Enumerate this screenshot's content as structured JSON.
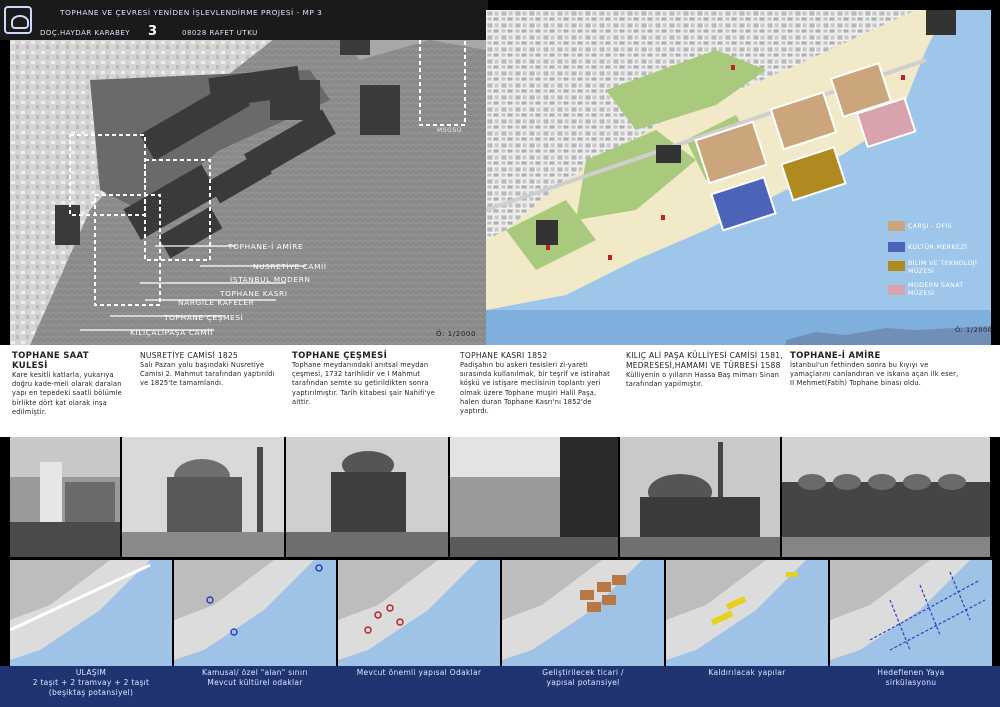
{
  "header": {
    "title": "TOPHANE VE ÇEVRESİ YENİDEN İŞLEVLENDİRME PROJESİ  - MP 3",
    "author": "DOÇ.HAYDAR KARABEY",
    "mp_number": "3",
    "student": "08028 RAFET UTKU"
  },
  "aerial": {
    "labels": [
      "TOPHANE-İ AMİRE",
      "NUSRETİYE CAMİİ",
      "İSTANBUL MODERN",
      "TOPHANE KASRI",
      "NARGİLE KAFELER",
      "TOPHANE ÇEŞMESİ",
      "KILIÇALİPAŞA CAMİİ"
    ],
    "msgsu": "MSGSÜ",
    "scale": "Ö: 1/2000"
  },
  "plan": {
    "legend": [
      {
        "label": "ÇARŞI - OFİS",
        "color": "#cba57b"
      },
      {
        "label": "KÜLTÜR MERKEZİ",
        "color": "#4b63b8"
      },
      {
        "label": "BİLİM VE TEKNOLOJİ MÜZESİ",
        "color": "#b08a1e"
      },
      {
        "label": "MODERN SANAT MÜZESİ",
        "color": "#d9a3ad"
      }
    ],
    "scale": "Ö: 1/2000"
  },
  "columns": [
    {
      "title": "TOPHANE SAAT KULESİ",
      "subtitle": "",
      "body": "Kare kesitli katlarla, yukarıya doğru kade-meli olarak daralan yapı en tepedeki saatli bölümle birlikte dört kat olarak inşa edilmiştir."
    },
    {
      "title": "",
      "subtitle": "NUSRETİYE CAMİSİ 1825",
      "body": "Salı Pazarı yolu başındaki Nusretiye Camisi 2. Mahmut tarafından yaptırıldı ve 1825'te tamamlandı."
    },
    {
      "title": "TOPHANE ÇEŞMESİ",
      "subtitle": "",
      "body": "Tophane meydanındaki anıtsal meydan çeşmesi, 1732 tarihlidir ve I Mahmut tarafından semte su getirildikten sonra yaptırılmıştır. Tarih kitabesi şair Nahifi'ye aittir."
    },
    {
      "title": "",
      "subtitle": "TOPHANE KASRI 1852",
      "body": "Padişahın bu askeri tesisleri zi-yareti sırasında kullanılmak, bir teşrif ve istirahat köşkü ve istişare meclisinin toplantı yeri olmak üzere Tophane muşiri Halil Paşa, halen duran Tophane Kasrı'nı 1852'de yaptırdı."
    },
    {
      "title": "",
      "subtitle": "KILIÇ ALİ PAŞA KÜLLİYESİ CAMİSİ 1581, MEDRESESİ,HAMAMI VE TÜRBESİ 1588",
      "body": "Külliyenin o yılların Hassa Baş mimarı Sinan tarafından yapılmıştır."
    },
    {
      "title": "TOPHANE-İ AMİRE",
      "subtitle": "",
      "body": " İstanbul'un fethinden sonra bu kıyıyı ve yamaçlarını canlandıran ve iskana açan ilk eser, II Mehmet(Fatih) Tophane binası oldu."
    }
  ],
  "bottom_labels": [
    "ULAŞIM\n2 taşıt + 2 tramvay + 2 taşıt\n(beşiktaş potansiyel)",
    "Kamusal/ özel \"alan\" sınırı\nMevcut kültürel odaklar",
    "Mevcut önemli yapısal Odaklar",
    "Geliştirilecek ticari /\nyapısal potansiyel",
    "Kaldırılacak yapılar",
    "Hedeflenen Yaya\nsirkülasyonu"
  ]
}
